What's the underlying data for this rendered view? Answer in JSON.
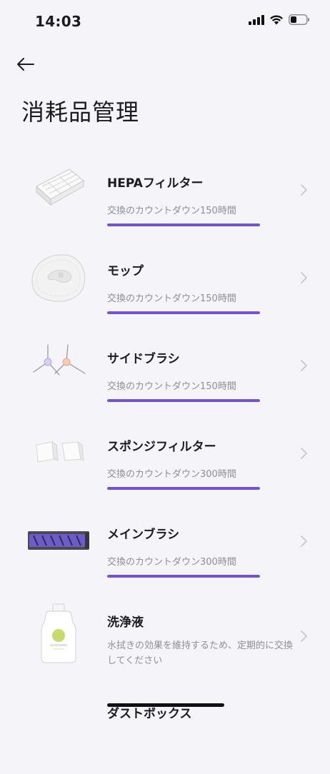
{
  "status_bar": {
    "time": "14:03"
  },
  "header": {
    "title": "消耗品管理"
  },
  "accent_color": "#7452d8",
  "items": [
    {
      "name": "HEPAフィルター",
      "subtitle": "交換のカウントダウン150時間",
      "remaining": 1.0,
      "icon": "hepa-filter-image"
    },
    {
      "name": "モップ",
      "subtitle": "交換のカウントダウン150時間",
      "remaining": 1.0,
      "icon": "mop-pad-image"
    },
    {
      "name": "サイドブラシ",
      "subtitle": "交換のカウントダウン150時間",
      "remaining": 1.0,
      "icon": "side-brush-image"
    },
    {
      "name": "スポンジフィルター",
      "subtitle": "交換のカウントダウン300時間",
      "remaining": 1.0,
      "icon": "sponge-filter-image"
    },
    {
      "name": "メインブラシ",
      "subtitle": "交換のカウントダウン300時間",
      "remaining": 1.0,
      "icon": "main-brush-image"
    },
    {
      "name": "洗浄液",
      "description": "水拭きの効果を維持するため、定期的に交換してください",
      "icon": "cleaning-solution-image"
    },
    {
      "name": "ダストボックス",
      "icon": "dust-box-image"
    }
  ]
}
